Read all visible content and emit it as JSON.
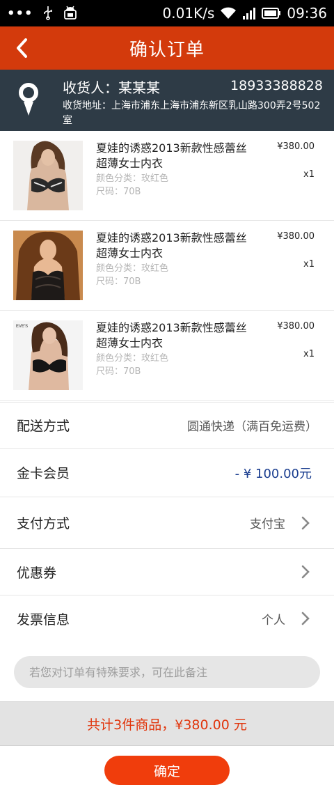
{
  "status_bar": {
    "dots": "•••",
    "network_speed": "0.01K/s",
    "time": "09:36",
    "icons": [
      "usb-icon",
      "android-debug-icon",
      "wifi-icon",
      "signal-icon",
      "battery-icon"
    ]
  },
  "header": {
    "title": "确认订单",
    "back_icon": "chevron-left-icon"
  },
  "address": {
    "recipient": "收货人：某某某",
    "phone": "18933388828",
    "detail": "收货地址：上海市浦东上海市浦东新区乳山路300弄2号502室",
    "icon": "location-pin-icon"
  },
  "products": [
    {
      "name": "夏娃的诱惑2013新款性感蕾丝超薄女士内衣",
      "color": "颜色分类：玫红色",
      "size": "尺码：70B",
      "price": "¥380.00",
      "qty": "x1"
    },
    {
      "name": "夏娃的诱惑2013新款性感蕾丝超薄女士内衣",
      "color": "颜色分类：玫红色",
      "size": "尺码：70B",
      "price": "¥380.00",
      "qty": "x1"
    },
    {
      "name": "夏娃的诱惑2013新款性感蕾丝超薄女士内衣",
      "color": "颜色分类：玫红色",
      "size": "尺码：70B",
      "price": "¥380.00",
      "qty": "x1"
    }
  ],
  "options": {
    "shipping": {
      "label": "配送方式",
      "value": "圆通快递（满百免运费）"
    },
    "member": {
      "label": "金卡会员",
      "value": "- ¥ 100.00元"
    },
    "payment": {
      "label": "支付方式",
      "value": "支付宝"
    },
    "coupon": {
      "label": "优惠券",
      "value": ""
    },
    "invoice": {
      "label": "发票信息",
      "value": "个人"
    }
  },
  "remark": {
    "placeholder": "若您对订单有特殊要求，可在此备注"
  },
  "summary": {
    "total_text": "共计3件商品，¥380.00 元"
  },
  "actions": {
    "confirm_label": "确定"
  },
  "colors": {
    "header_bg": "#d33a0c",
    "address_bg": "#2e3b46",
    "accent": "#f03d0c",
    "discount": "#1a3d8f"
  }
}
